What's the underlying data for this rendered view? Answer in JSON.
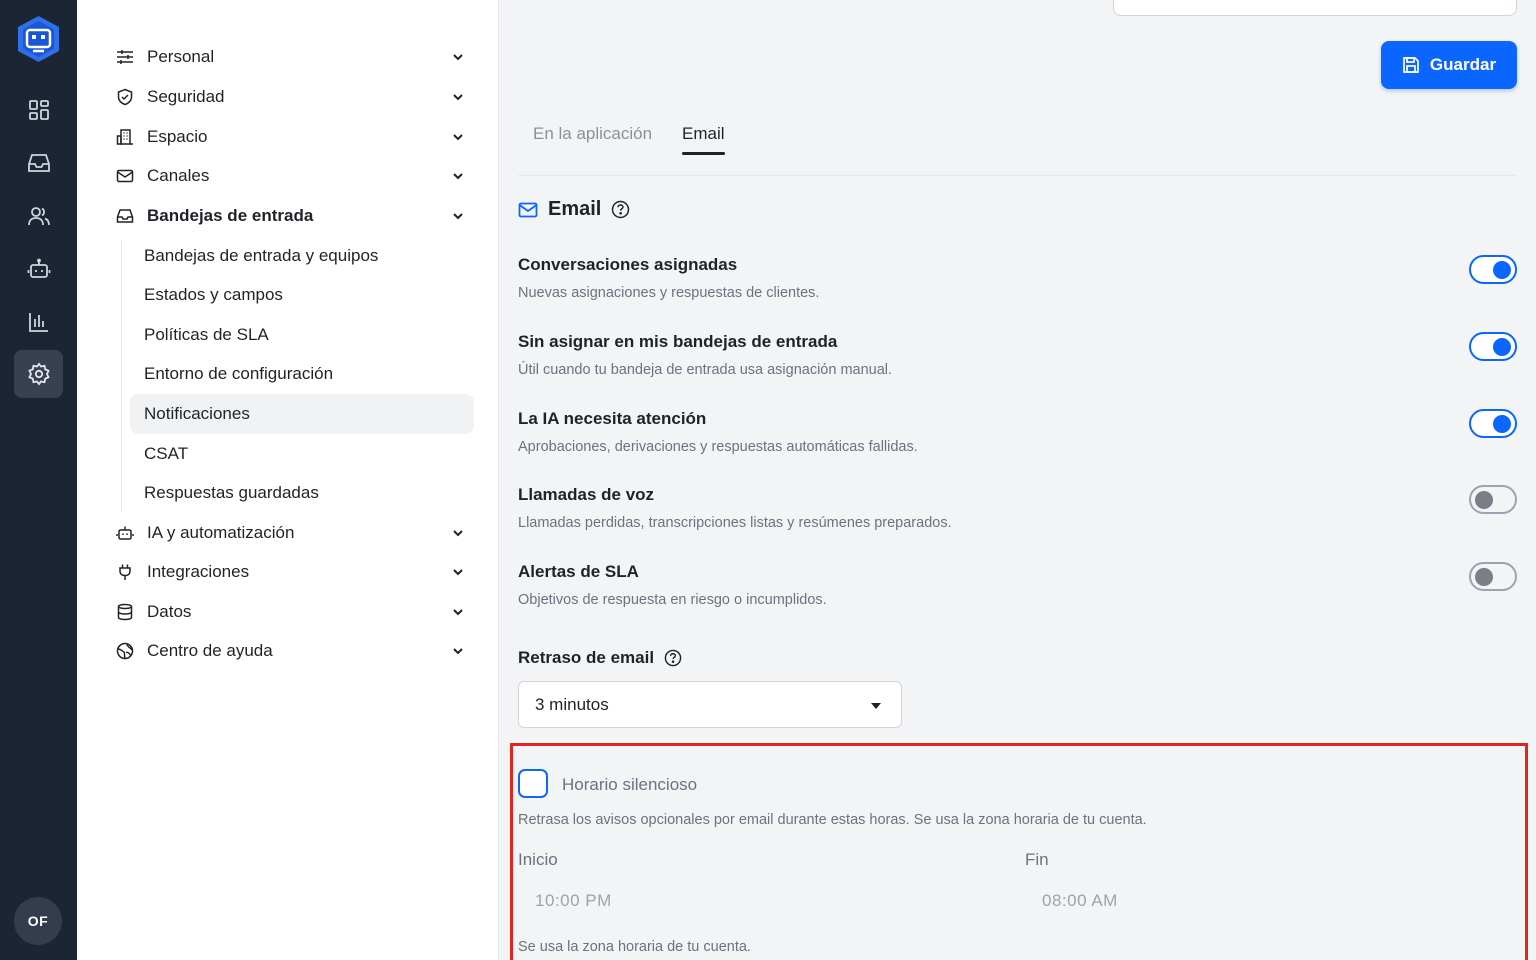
{
  "rail": {
    "icons": [
      "logo-icon",
      "dashboard-icon",
      "inbox-icon",
      "contacts-icon",
      "bot-icon",
      "reports-icon",
      "settings-icon"
    ],
    "avatar_initials": "OF"
  },
  "nav": {
    "items": [
      {
        "label": "Personal",
        "icon": "sliders-icon"
      },
      {
        "label": "Seguridad",
        "icon": "shield-icon"
      },
      {
        "label": "Espacio",
        "icon": "building-icon"
      },
      {
        "label": "Canales",
        "icon": "mail-icon"
      },
      {
        "label": "Bandejas de entrada",
        "icon": "inbox-icon"
      },
      {
        "label": "IA y automatización",
        "icon": "bot-icon"
      },
      {
        "label": "Integraciones",
        "icon": "plug-icon"
      },
      {
        "label": "Datos",
        "icon": "database-icon"
      },
      {
        "label": "Centro de ayuda",
        "icon": "globe-icon"
      }
    ],
    "subitems": [
      "Bandejas de entrada y equipos",
      "Estados y campos",
      "Políticas de SLA",
      "Entorno de configuración",
      "Notificaciones",
      "CSAT",
      "Respuestas guardadas"
    ],
    "active_subitem": "Notificaciones"
  },
  "header": {
    "save_label": "Guardar"
  },
  "tabs": [
    "En la aplicación",
    "Email"
  ],
  "active_tab": "Email",
  "section": {
    "title": "Email"
  },
  "options": [
    {
      "title": "Conversaciones asignadas",
      "desc": "Nuevas asignaciones y respuestas de clientes.",
      "enabled": true
    },
    {
      "title": "Sin asignar en mis bandejas de entrada",
      "desc": "Útil cuando tu bandeja de entrada usa asignación manual.",
      "enabled": true
    },
    {
      "title": "La IA necesita atención",
      "desc": "Aprobaciones, derivaciones y respuestas automáticas fallidas.",
      "enabled": true
    },
    {
      "title": "Llamadas de voz",
      "desc": "Llamadas perdidas, transcripciones listas y resúmenes preparados.",
      "enabled": false
    },
    {
      "title": "Alertas de SLA",
      "desc": "Objetivos de respuesta en riesgo o incumplidos.",
      "enabled": false
    }
  ],
  "delay": {
    "label": "Retraso de email",
    "value": "3 minutos"
  },
  "quiet_hours": {
    "title": "Horario silencioso",
    "checked": false,
    "desc": "Retrasa los avisos opcionales por email durante estas horas. Se usa la zona horaria de tu cuenta.",
    "start_label": "Inicio",
    "start_value": "10:00 PM",
    "end_label": "Fin",
    "end_value": "08:00 AM",
    "note": "Se usa la zona horaria de tu cuenta."
  },
  "colors": {
    "accent": "#0a66ff",
    "rail": "#1c2533",
    "highlight_border": "#e02424"
  }
}
